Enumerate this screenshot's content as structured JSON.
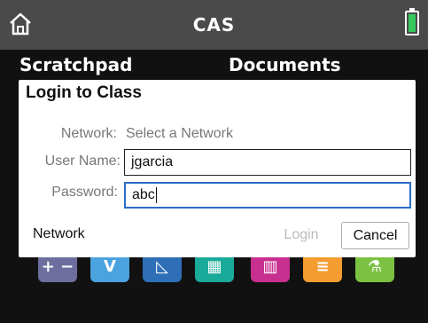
{
  "header": {
    "title": "CAS",
    "home_icon": "home-icon",
    "battery_icon": "battery-icon",
    "battery_color": "#34c759"
  },
  "tabs": {
    "scratchpad": "Scratchpad",
    "documents": "Documents"
  },
  "dialog": {
    "title": "Login to Class",
    "network_label": "Network:",
    "network_value": "Select a Network",
    "username_label": "User Name:",
    "username_value": "jgarcia",
    "password_label": "Password:",
    "password_value": "abc",
    "network_button": "Network",
    "login_button": "Login",
    "cancel_button": "Cancel"
  },
  "apps": [
    {
      "name": "calculator-app-icon",
      "symbol": "+ −",
      "color": "#6e6e9e"
    },
    {
      "name": "graphs-app-icon",
      "symbol": "V",
      "color": "#4aa3df"
    },
    {
      "name": "geometry-app-icon",
      "symbol": "◺",
      "color": "#2e6fb8"
    },
    {
      "name": "lists-app-icon",
      "symbol": "▦",
      "color": "#1aaa9a"
    },
    {
      "name": "data-stats-app-icon",
      "symbol": "▥",
      "color": "#c8308f"
    },
    {
      "name": "notes-app-icon",
      "symbol": "≡",
      "color": "#f39c2f"
    },
    {
      "name": "vernier-app-icon",
      "symbol": "⚗",
      "color": "#7cc242"
    }
  ]
}
